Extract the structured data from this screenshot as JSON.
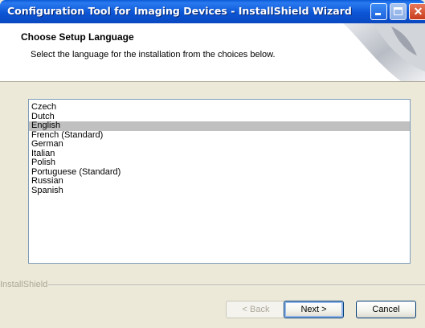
{
  "window": {
    "title": "Configuration Tool for Imaging Devices - InstallShield Wizard"
  },
  "header": {
    "title": "Choose Setup Language",
    "subtitle": "Select the language for the installation from the choices below."
  },
  "languages": [
    "Czech",
    "Dutch",
    "English",
    "French (Standard)",
    "German",
    "Italian",
    "Polish",
    "Portuguese (Standard)",
    "Russian",
    "Spanish"
  ],
  "selected_language": "English",
  "footer": {
    "brand": "InstallShield",
    "back_label": "< Back",
    "next_label": "Next >",
    "cancel_label": "Cancel"
  },
  "colors": {
    "title_bar": "#0a5ad8",
    "selection": "#c0c0c0",
    "dialog_bg": "#ece9d8"
  }
}
